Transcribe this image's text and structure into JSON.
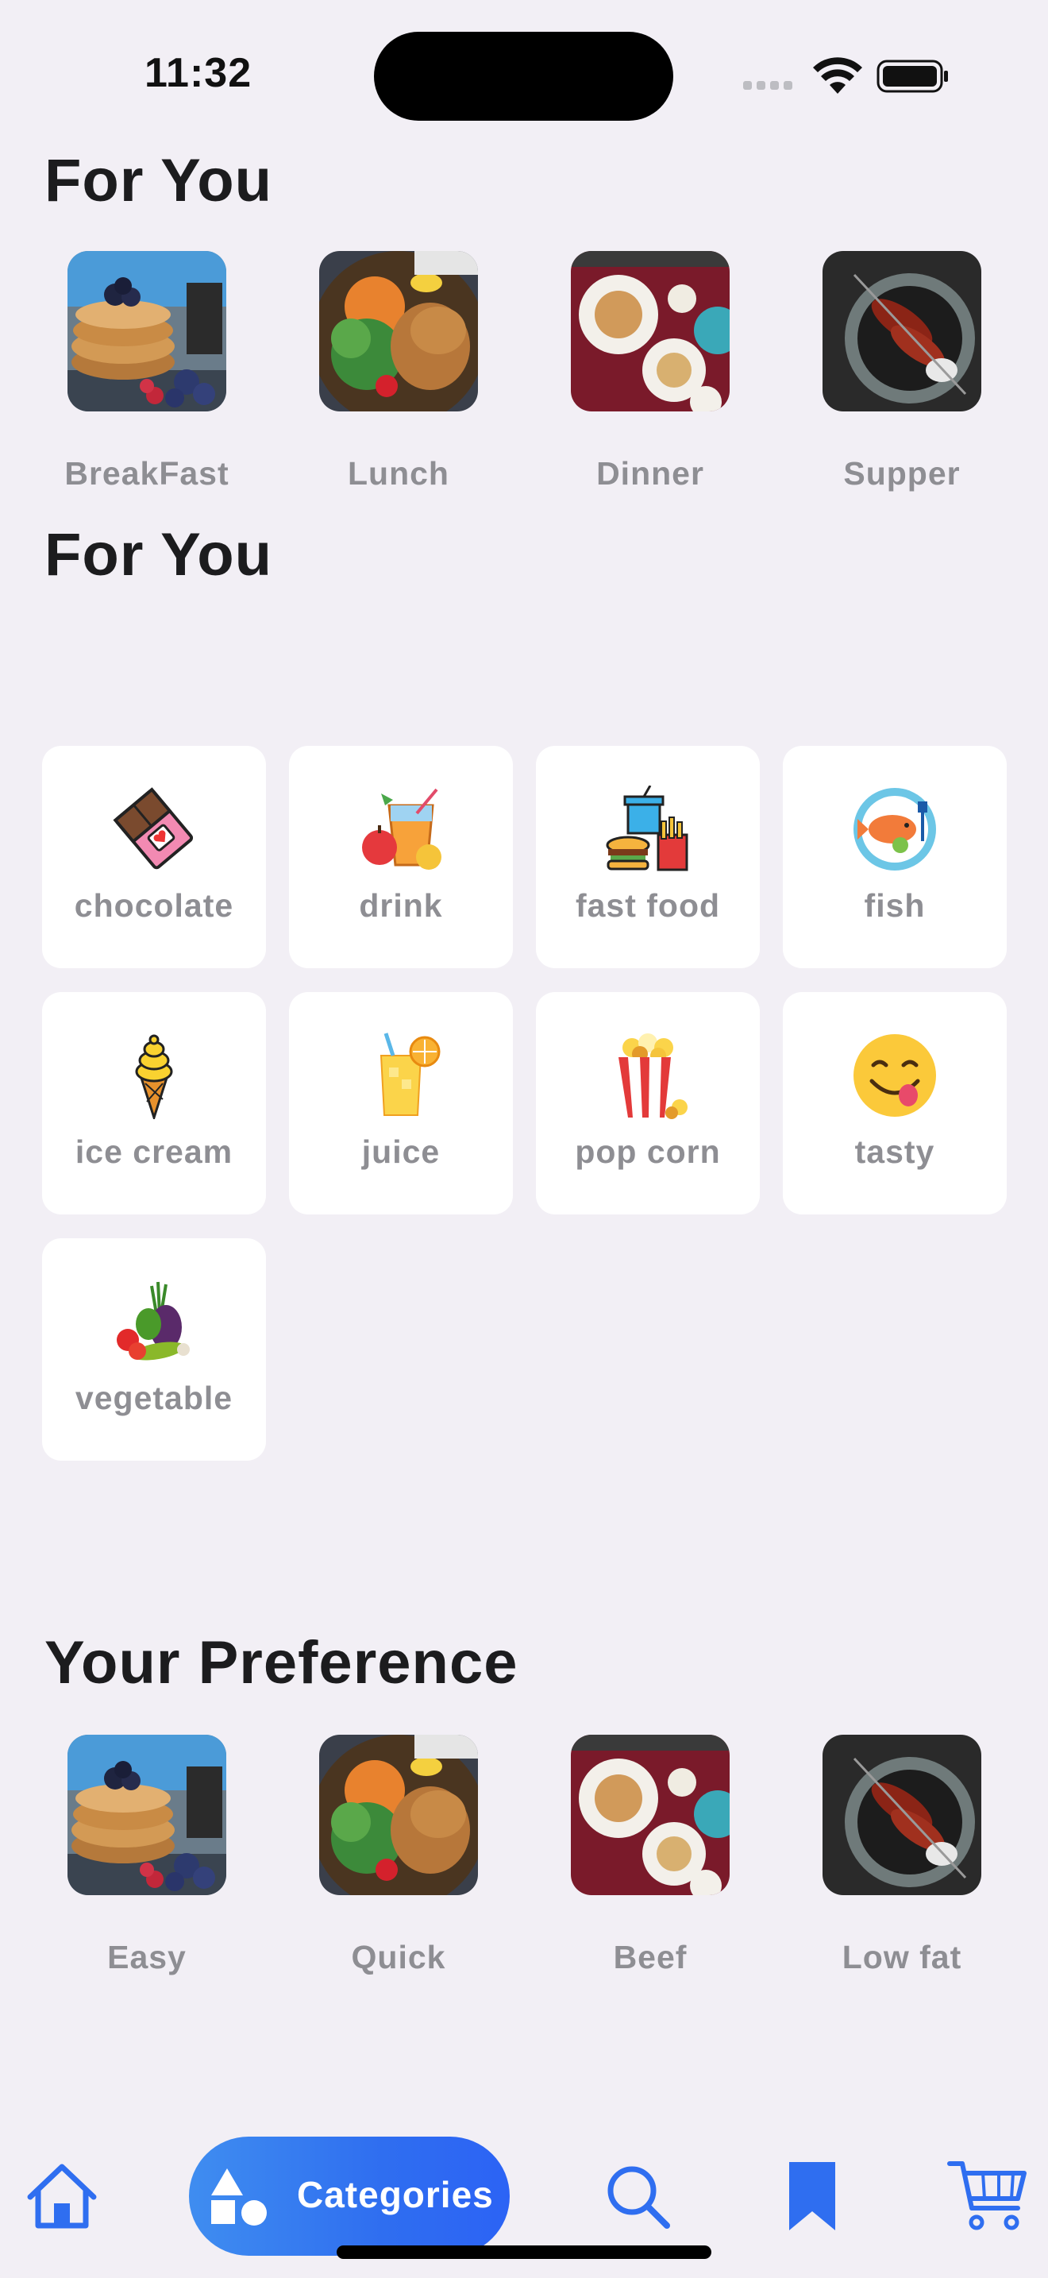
{
  "status_bar": {
    "time": "11:32"
  },
  "sections": {
    "for_you_1": {
      "title": "For You"
    },
    "for_you_2": {
      "title": "For You"
    },
    "preference": {
      "title": "Your Preference"
    }
  },
  "meals": [
    {
      "label": "BreakFast",
      "image": "pancakes-photo"
    },
    {
      "label": "Lunch",
      "image": "salad-chicken-photo"
    },
    {
      "label": "Dinner",
      "image": "dinner-table-photo"
    },
    {
      "label": "Supper",
      "image": "kebab-plate-photo"
    }
  ],
  "categories": [
    {
      "label": "chocolate",
      "icon": "chocolate-icon"
    },
    {
      "label": "drink",
      "icon": "drink-icon"
    },
    {
      "label": "fast food",
      "icon": "fast-food-icon"
    },
    {
      "label": "fish",
      "icon": "fish-icon"
    },
    {
      "label": "ice cream",
      "icon": "ice-cream-icon"
    },
    {
      "label": "juice",
      "icon": "juice-icon"
    },
    {
      "label": "pop corn",
      "icon": "popcorn-icon"
    },
    {
      "label": "tasty",
      "icon": "tasty-face-icon"
    },
    {
      "label": "vegetable",
      "icon": "vegetable-icon"
    }
  ],
  "preferences": [
    {
      "label": "Easy",
      "image": "pancakes-photo"
    },
    {
      "label": "Quick",
      "image": "salad-chicken-photo"
    },
    {
      "label": "Beef",
      "image": "dinner-table-photo"
    },
    {
      "label": "Low fat",
      "image": "kebab-plate-photo"
    }
  ],
  "bottom_nav": {
    "categories_label": "Categories",
    "items": [
      "home-icon",
      "categories-icon",
      "search-icon",
      "bookmark-icon",
      "cart-icon"
    ],
    "accent": "#2f6ef0"
  },
  "colors": {
    "background": "#f2eff5",
    "label_gray": "#8e8e93",
    "accent": "#2f6ef0"
  }
}
